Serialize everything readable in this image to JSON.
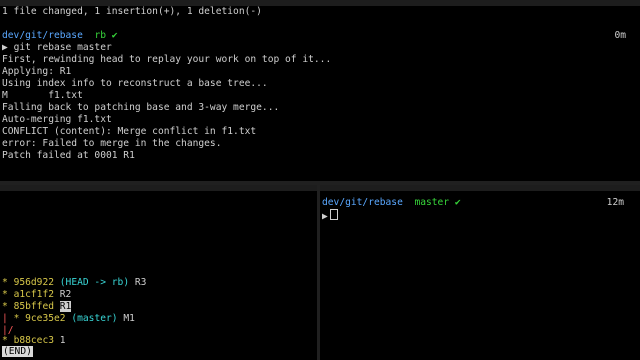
{
  "top": {
    "title": "",
    "lines": [
      "1 file changed, 1 insertion(+), 1 deletion(-)"
    ],
    "prompt_path": "dev/git/rebase",
    "prompt_branch": "rb",
    "prompt_check": "✔",
    "prompt_time": "0m",
    "prompt_arrow": "▶",
    "command": "git rebase master",
    "output": [
      "First, rewinding head to replay your work on top of it...",
      "Applying: R1",
      "Using index info to reconstruct a base tree...",
      "M       f1.txt",
      "Falling back to patching base and 3-way merge...",
      "Auto-merging f1.txt",
      "CONFLICT (content): Merge conflict in f1.txt",
      "error: Failed to merge in the changes.",
      "Patch failed at 0001 R1"
    ]
  },
  "left": {
    "title": "",
    "log": {
      "row1": {
        "star": "*",
        "hash": "956d922",
        "refs": "(HEAD -> rb)",
        "msg": "R3"
      },
      "row2": {
        "star": "*",
        "hash": "a1cf1f2",
        "msg": "R2"
      },
      "row3": {
        "star": "*",
        "hash": "85bffed",
        "msg": "R1"
      },
      "row4": {
        "graph": "|",
        "star": "*",
        "hash": "9ce35e2",
        "refs": "(master)",
        "msg": "M1"
      },
      "row5": {
        "graph": "|/"
      },
      "row6": {
        "star": "*",
        "hash": "b88cec3",
        "msg": "1"
      }
    },
    "end_label": "(END)"
  },
  "right": {
    "title": "",
    "prompt_path": "dev/git/rebase",
    "prompt_branch": "master",
    "prompt_check": "✔",
    "prompt_time": "12m",
    "prompt_arrow": "▶"
  }
}
